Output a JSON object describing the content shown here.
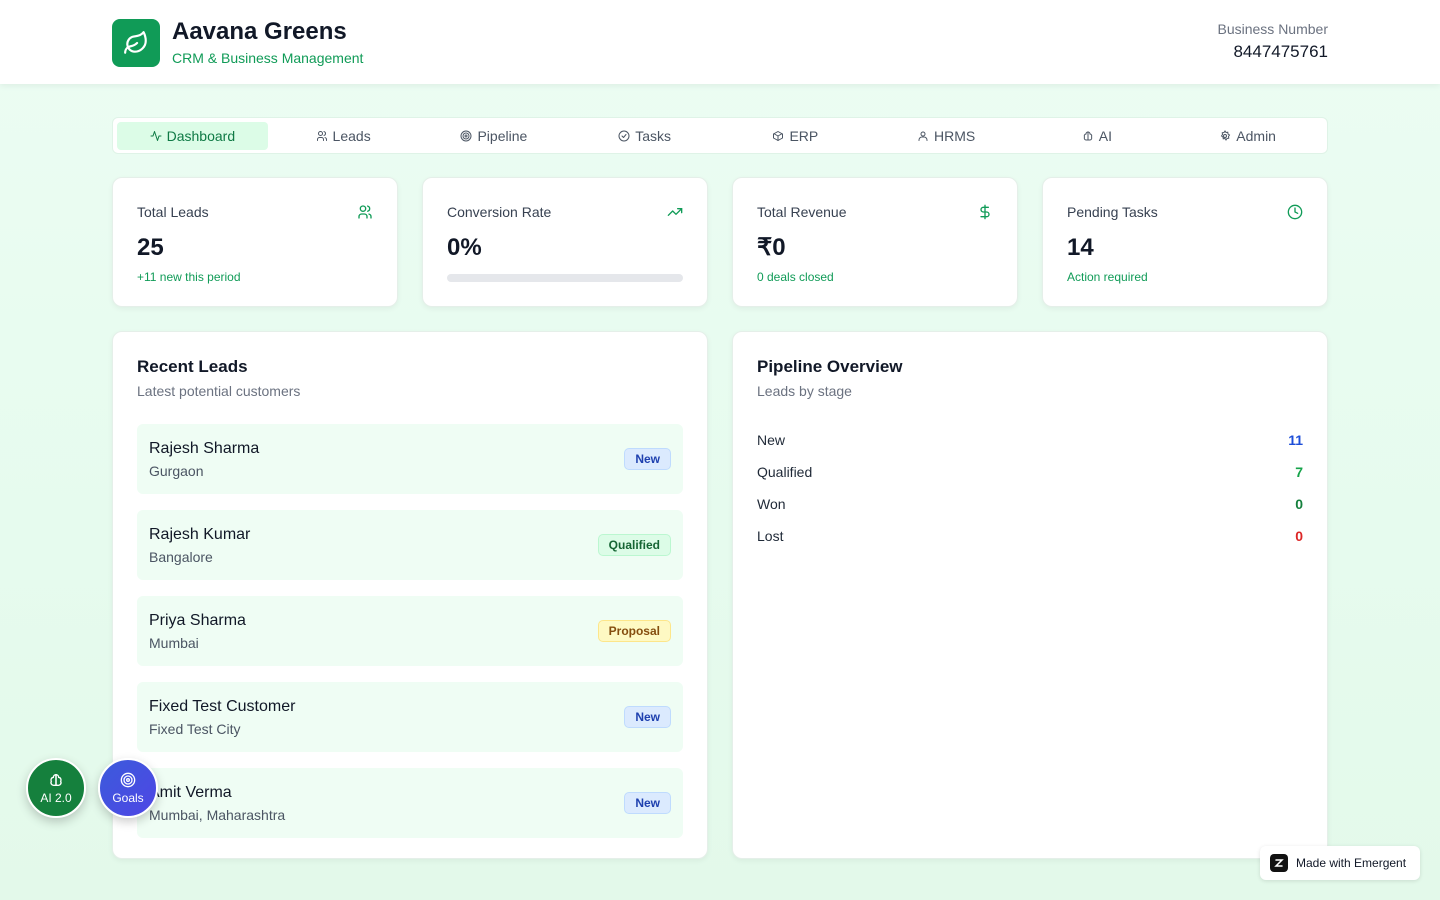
{
  "header": {
    "title": "Aavana Greens",
    "subtitle": "CRM & Business Management",
    "business_label": "Business Number",
    "business_number": "8447475761"
  },
  "tabs": [
    {
      "label": "Dashboard",
      "icon": "activity-icon",
      "active": true
    },
    {
      "label": "Leads",
      "icon": "users-icon",
      "active": false
    },
    {
      "label": "Pipeline",
      "icon": "target-icon",
      "active": false
    },
    {
      "label": "Tasks",
      "icon": "check-circle-icon",
      "active": false
    },
    {
      "label": "ERP",
      "icon": "package-icon",
      "active": false
    },
    {
      "label": "HRMS",
      "icon": "user-icon",
      "active": false
    },
    {
      "label": "AI",
      "icon": "brain-icon",
      "active": false
    },
    {
      "label": "Admin",
      "icon": "settings-icon",
      "active": false
    }
  ],
  "stats": [
    {
      "title": "Total Leads",
      "value": "25",
      "sub": "+11 new this period",
      "icon": "users-icon"
    },
    {
      "title": "Conversion Rate",
      "value": "0%",
      "progress": 0,
      "icon": "trending-up-icon"
    },
    {
      "title": "Total Revenue",
      "value": "₹0",
      "sub": "0 deals closed",
      "icon": "dollar-icon"
    },
    {
      "title": "Pending Tasks",
      "value": "14",
      "sub": "Action required",
      "icon": "clock-icon"
    }
  ],
  "recent_leads": {
    "title": "Recent Leads",
    "subtitle": "Latest potential customers",
    "items": [
      {
        "name": "Rajesh Sharma",
        "city": "Gurgaon",
        "status": "New"
      },
      {
        "name": "Rajesh Kumar",
        "city": "Bangalore",
        "status": "Qualified"
      },
      {
        "name": "Priya Sharma",
        "city": "Mumbai",
        "status": "Proposal"
      },
      {
        "name": "Fixed Test Customer",
        "city": "Fixed Test City",
        "status": "New"
      },
      {
        "name": "Amit Verma",
        "city": "Mumbai, Maharashtra",
        "status": "New"
      }
    ]
  },
  "pipeline": {
    "title": "Pipeline Overview",
    "subtitle": "Leads by stage",
    "stages": [
      {
        "name": "New",
        "count": "11",
        "color": "#1d4ed8"
      },
      {
        "name": "Qualified",
        "count": "7",
        "color": "#16a34a"
      },
      {
        "name": "Won",
        "count": "0",
        "color": "#15803d"
      },
      {
        "name": "Lost",
        "count": "0",
        "color": "#dc2626"
      }
    ]
  },
  "fabs": {
    "ai_label": "AI 2.0",
    "goals_label": "Goals"
  },
  "made_with": "Made with Emergent",
  "colors": {
    "brand": "#109b57",
    "accent_bg": "#dcfce7"
  }
}
